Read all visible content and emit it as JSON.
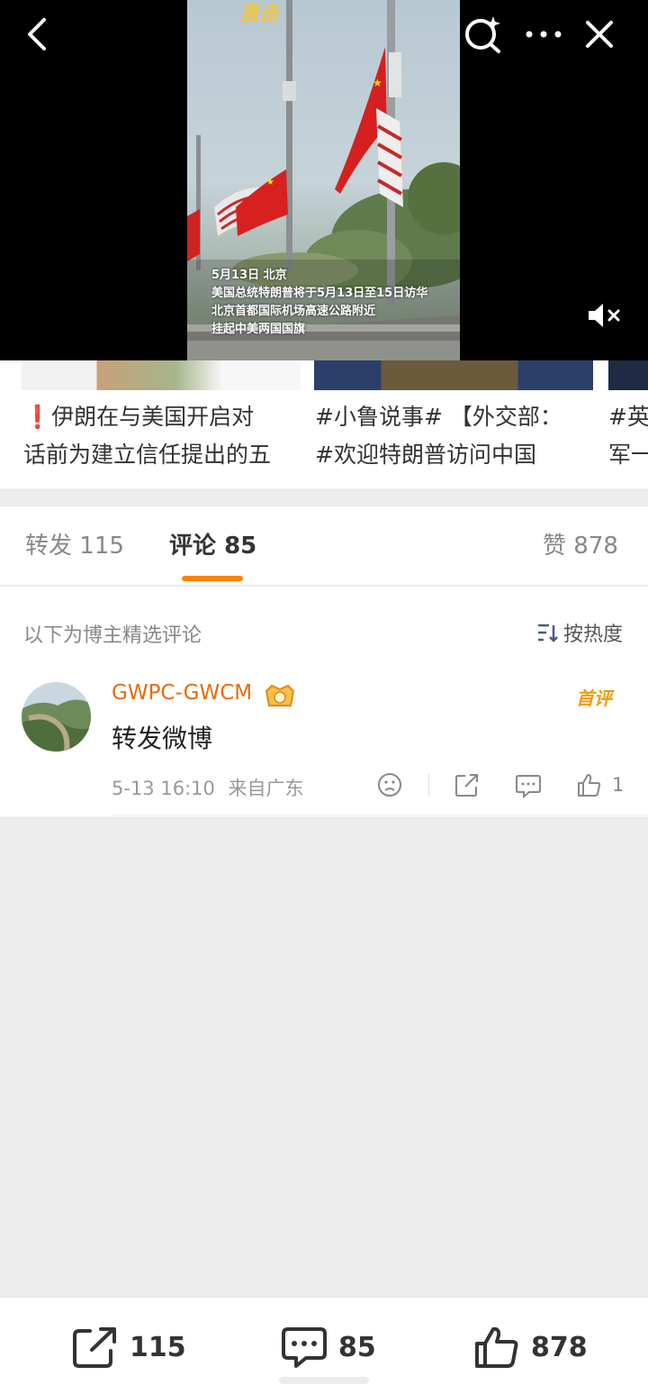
{
  "video": {
    "brand_text": "直击",
    "caption": {
      "line1": "5月13日 北京",
      "line2": "美国总统特朗普将于5月13日至15日访华",
      "line3": "北京首都国际机场高速公路附近",
      "line4": "挂起中美两国国旗"
    },
    "icons": {
      "back": "chevron-left-icon",
      "search": "search-sparkle-icon",
      "more": "more-dots-icon",
      "close": "close-icon",
      "mute": "speaker-muted-icon"
    }
  },
  "related": [
    {
      "title_line1": "伊朗在与美国开启对",
      "title_line2": "话前为建立信任提出的五",
      "alert_icon": "❗"
    },
    {
      "title_line1": "#小鲁说事# 【外交部：",
      "title_line2": "#欢迎特朗普访问中国"
    },
    {
      "title_line1": "#英",
      "title_line2": "军一"
    }
  ],
  "tabs": {
    "repost": {
      "label": "转发",
      "count": "115"
    },
    "comment": {
      "label": "评论",
      "count": "85"
    },
    "like": {
      "label": "赞",
      "count": "878"
    }
  },
  "comments_section": {
    "hint": "以下为博主精选评论",
    "sort_label": "按热度"
  },
  "comment": {
    "username": "GWPC-GWCM",
    "badge": "首评",
    "text": "转发微博",
    "time": "5-13 16:10",
    "location": "来自广东",
    "likes": "1"
  },
  "bottom_bar": {
    "repost_count": "115",
    "comment_count": "85",
    "like_count": "878"
  },
  "colors": {
    "accent_orange": "#ff8200",
    "username": "#e86b0a",
    "background": "#ededed"
  }
}
